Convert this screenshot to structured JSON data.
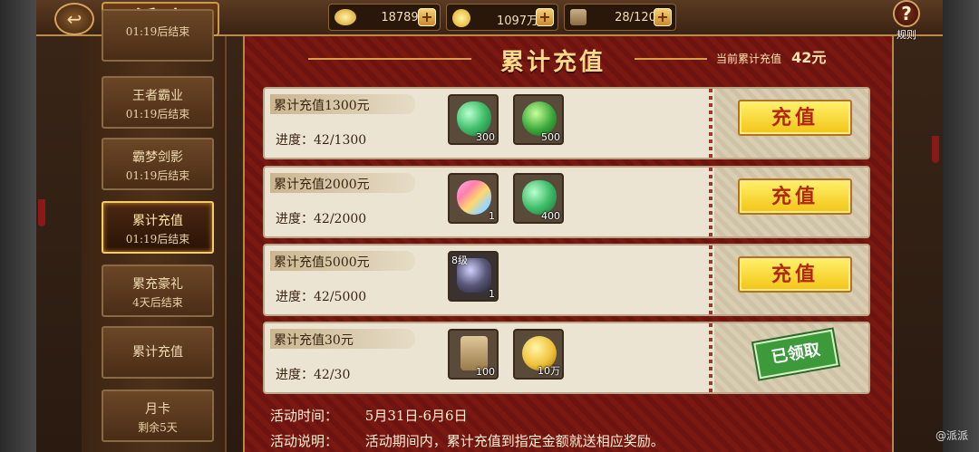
{
  "header": {
    "title": "活动",
    "back_icon": "back-arrow-icon",
    "help_label": "规则",
    "help_glyph": "?"
  },
  "resources": [
    {
      "icon": "gold-ingot-icon",
      "value": "18789"
    },
    {
      "icon": "coin-icon",
      "value": "1097万"
    },
    {
      "icon": "bronze-vessel-icon",
      "value": "28/120"
    }
  ],
  "resource_plus": "+",
  "sidebar": {
    "items": [
      {
        "line1": "",
        "line2": "01:19后结束"
      },
      {
        "line1": "王者霸业",
        "line2": "01:19后结束"
      },
      {
        "line1": "霸梦剑影",
        "line2": "01:19后结束"
      },
      {
        "line1": "累计充值",
        "line2": "01:19后结束"
      },
      {
        "line1": "累充豪礼",
        "line2": "4天后结束"
      },
      {
        "line1": "累计充值",
        "line2": ""
      },
      {
        "line1": "月卡",
        "line2": "剩余5天"
      }
    ]
  },
  "main": {
    "title": "累计充值",
    "current_label": "当前累计充值",
    "current_amount": "42元",
    "rows": [
      {
        "title": "累计充值1300元",
        "progress": "进度：42/1300",
        "items": [
          {
            "qty": "300",
            "color": "#3fbf6a"
          },
          {
            "qty": "500",
            "color": "#2f9a3a"
          }
        ],
        "action": "充值"
      },
      {
        "title": "累计充值2000元",
        "progress": "进度：42/2000",
        "items": [
          {
            "qty": "1",
            "color": "#e87ac0"
          },
          {
            "qty": "400",
            "color": "#3fbf6a"
          }
        ],
        "action": "充值"
      },
      {
        "title": "累计充值5000元",
        "progress": "进度：42/5000",
        "items": [
          {
            "qty": "1",
            "level": "8级",
            "color": "#6a6a8a"
          }
        ],
        "action": "充值"
      },
      {
        "title": "累计充值30元",
        "progress": "进度：42/30",
        "items": [
          {
            "qty": "100",
            "color": "#b39060"
          },
          {
            "qty": "10万",
            "color": "#f0c23a"
          }
        ],
        "action": "已领取"
      }
    ],
    "info": {
      "time_label": "活动时间：",
      "time_value": "5月31日-6月6日",
      "desc_label": "活动说明：",
      "desc_value": "活动期间内，累计充值到指定金额就送相应奖励。"
    }
  },
  "watermark": "@派派"
}
